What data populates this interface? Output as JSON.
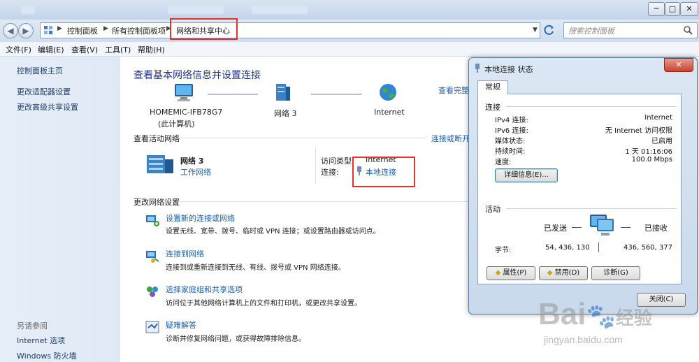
{
  "window": {
    "buttons": [
      "─",
      "□",
      "✕"
    ]
  },
  "address": {
    "breadcrumbs": [
      "控制面板",
      "所有控制面板项",
      "网络和共享中心"
    ],
    "search_placeholder": "搜索控制面板"
  },
  "menu": [
    "文件(F)",
    "编辑(E)",
    "查看(V)",
    "工具(T)",
    "帮助(H)"
  ],
  "sidebar": {
    "links": [
      "控制面板主页",
      "更改适配器设置",
      "更改高级共享设置"
    ],
    "see_also_title": "另请参阅",
    "see_also": [
      "Internet 选项",
      "Windows 防火墙"
    ]
  },
  "main": {
    "title": "查看基本网络信息并设置连接",
    "view_full_map": "查看完整",
    "map": {
      "computer_name": "HOMEMIC-IFB78G7",
      "computer_sub": "(此计算机)",
      "network": "网络  3",
      "internet": "Internet"
    },
    "active_networks": {
      "title": "查看活动网络",
      "connect_disconnect": "连接或断开",
      "network_name": "网络  3",
      "network_type": "工作网络",
      "access_type_label": "访问类型:",
      "access_type_value": "Internet",
      "connections_label": "连接:",
      "connection_name": "本地连接"
    },
    "change_settings": {
      "title": "更改网络设置",
      "tasks": [
        {
          "title": "设置新的连接或网络",
          "desc": "设置无线、宽带、拨号、临时或 VPN 连接；或设置路由器或访问点。"
        },
        {
          "title": "连接到网络",
          "desc": "连接到或重新连接到无线、有线、拨号或 VPN 网络连接。"
        },
        {
          "title": "选择家庭组和共享选项",
          "desc": "访问位于其他网络计算机上的文件和打印机，或更改共享设置。"
        },
        {
          "title": "疑难解答",
          "desc": "诊断并修复网络问题，或获得故障排除信息。"
        }
      ]
    }
  },
  "dialog": {
    "title": "本地连接 状态",
    "close_glyph": "✕",
    "tab": "常规",
    "connection_section": "连接",
    "rows": [
      {
        "label": "IPv4 连接:",
        "value": "Internet"
      },
      {
        "label": "IPv6 连接:",
        "value": "无 Internet 访问权限"
      },
      {
        "label": "媒体状态:",
        "value": "已启用"
      },
      {
        "label": "持续时间:",
        "value": "1 天 01:16:06"
      },
      {
        "label": "速度:",
        "value": "100.0 Mbps"
      }
    ],
    "details_button": "详细信息(E)...",
    "activity_section": "活动",
    "sent_label": "已发送",
    "received_label": "已接收",
    "bytes_label": "字节:",
    "bytes_sent": "54, 436, 130",
    "bytes_received": "436, 560, 377",
    "buttons": [
      "属性(P)",
      "禁用(D)",
      "诊断(G)"
    ],
    "close_button": "关闭(C)"
  },
  "watermark": {
    "brand_text": "Bai",
    "brand_suffix": "经验",
    "url": "jingyan.baidu.com"
  },
  "colors": {
    "link": "#1a5fb4",
    "heading": "#1e3287",
    "highlight_box": "#e5302b"
  }
}
